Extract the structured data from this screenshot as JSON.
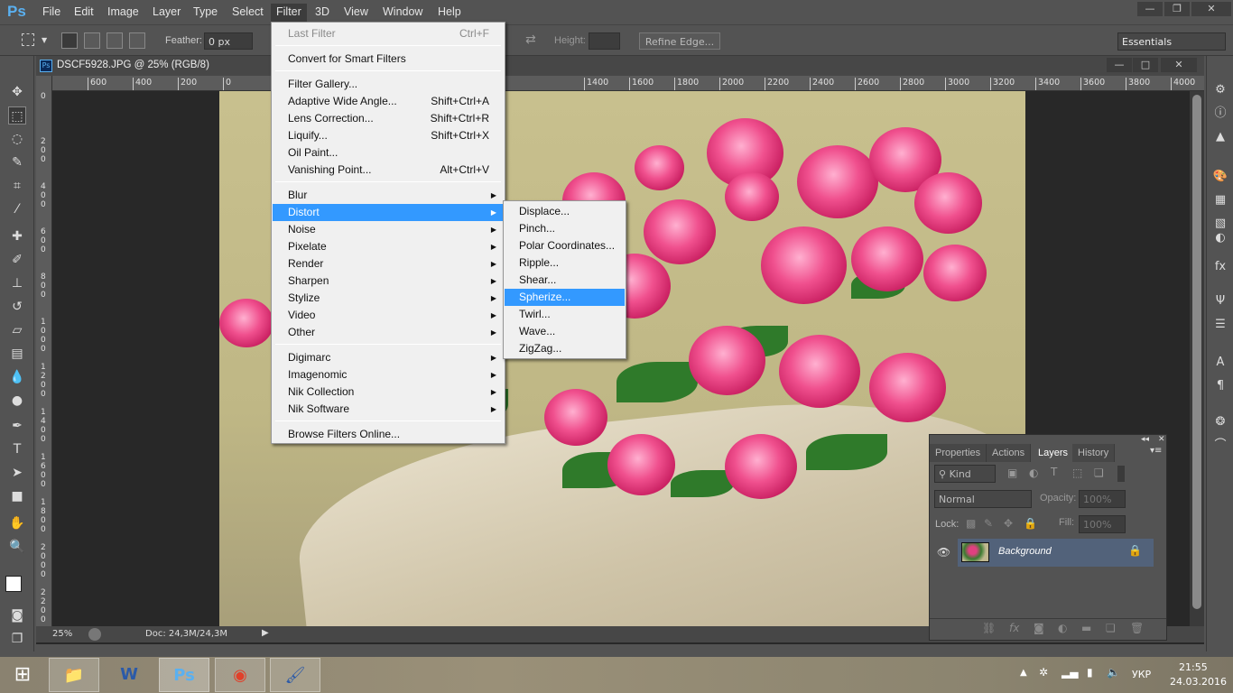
{
  "app": {
    "logo": "Ps",
    "menu": [
      "File",
      "Edit",
      "Image",
      "Layer",
      "Type",
      "Select",
      "Filter",
      "3D",
      "View",
      "Window",
      "Help"
    ],
    "active_menu": "Filter"
  },
  "options": {
    "feather_label": "Feather:",
    "feather_value": "0 px",
    "height_label": "Height:",
    "refine_edge": "Refine Edge...",
    "workspace": "Essentials"
  },
  "document": {
    "tab_title": "DSCF5928.JPG @ 25% (RGB/8)",
    "zoom": "25%",
    "doc_info": "Doc: 24,3M/24,3M",
    "ruler_top": [
      "600",
      "400",
      "200",
      "0",
      "1400",
      "1600",
      "1800",
      "2000",
      "2200",
      "2400",
      "2600",
      "2800",
      "3000",
      "3200",
      "3400",
      "3600",
      "3800",
      "4000"
    ],
    "ruler_left": [
      "0",
      "200",
      "400",
      "600",
      "800",
      "1000",
      "1200",
      "1400",
      "1600",
      "1800",
      "2000",
      "2200"
    ]
  },
  "filter_menu": {
    "items": [
      {
        "label": "Last Filter",
        "shortcut": "Ctrl+F",
        "disabled": true
      },
      {
        "label": "Convert for Smart Filters"
      },
      {
        "label": "Filter Gallery..."
      },
      {
        "label": "Adaptive Wide Angle...",
        "shortcut": "Shift+Ctrl+A"
      },
      {
        "label": "Lens Correction...",
        "shortcut": "Shift+Ctrl+R"
      },
      {
        "label": "Liquify...",
        "shortcut": "Shift+Ctrl+X"
      },
      {
        "label": "Oil Paint..."
      },
      {
        "label": "Vanishing Point...",
        "shortcut": "Alt+Ctrl+V"
      },
      {
        "label": "Blur",
        "submenu": true
      },
      {
        "label": "Distort",
        "submenu": true,
        "highlighted": true
      },
      {
        "label": "Noise",
        "submenu": true
      },
      {
        "label": "Pixelate",
        "submenu": true
      },
      {
        "label": "Render",
        "submenu": true
      },
      {
        "label": "Sharpen",
        "submenu": true
      },
      {
        "label": "Stylize",
        "submenu": true
      },
      {
        "label": "Video",
        "submenu": true
      },
      {
        "label": "Other",
        "submenu": true
      },
      {
        "label": "Digimarc",
        "submenu": true
      },
      {
        "label": "Imagenomic",
        "submenu": true
      },
      {
        "label": "Nik Collection",
        "submenu": true
      },
      {
        "label": "Nik Software",
        "submenu": true
      },
      {
        "label": "Browse Filters Online..."
      }
    ]
  },
  "distort_submenu": {
    "items": [
      "Displace...",
      "Pinch...",
      "Polar Coordinates...",
      "Ripple...",
      "Shear...",
      "Spherize...",
      "Twirl...",
      "Wave...",
      "ZigZag..."
    ],
    "highlighted": "Spherize..."
  },
  "layers_panel": {
    "tabs": [
      "Properties",
      "Actions",
      "Layers",
      "History"
    ],
    "active_tab": "Layers",
    "filter_kind": "Kind",
    "blend_mode": "Normal",
    "opacity_label": "Opacity:",
    "opacity": "100%",
    "lock_label": "Lock:",
    "fill_label": "Fill:",
    "fill": "100%",
    "layers": [
      {
        "name": "Background",
        "visible": true,
        "locked": true
      }
    ]
  },
  "taskbar": {
    "apps": [
      "explorer",
      "word",
      "photoshop",
      "chrome",
      "paint"
    ],
    "active": "photoshop",
    "language": "УКР",
    "time": "21:55",
    "date": "24.03.2016"
  },
  "colors": {
    "accent": "#3399ff",
    "ui_bg": "#535353",
    "menu_bg": "#f0f0f0",
    "layer_selected": "#52627a"
  }
}
